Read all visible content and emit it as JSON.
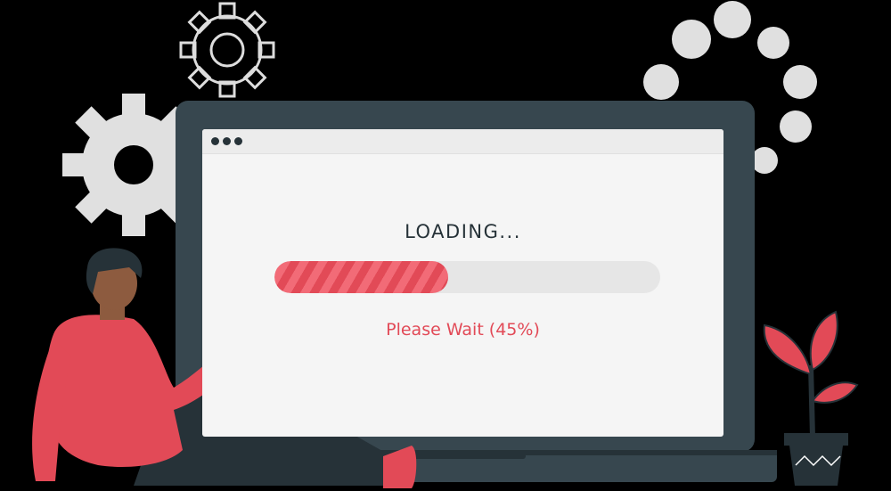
{
  "loading": {
    "title": "LOADING...",
    "progress": 0.45,
    "status_text": "Please Wait (45%)"
  },
  "colors": {
    "accent": "#e24a57",
    "accent_light": "#f26b77",
    "laptop_frame": "#37474f",
    "laptop_dark": "#263238",
    "screen_bg": "#f5f5f5",
    "gear": "#e0e0e0"
  },
  "icons": [
    "gear-icon",
    "loading-dots-icon",
    "coffee-mug-icon",
    "plant-icon",
    "browser-dots-icon"
  ]
}
